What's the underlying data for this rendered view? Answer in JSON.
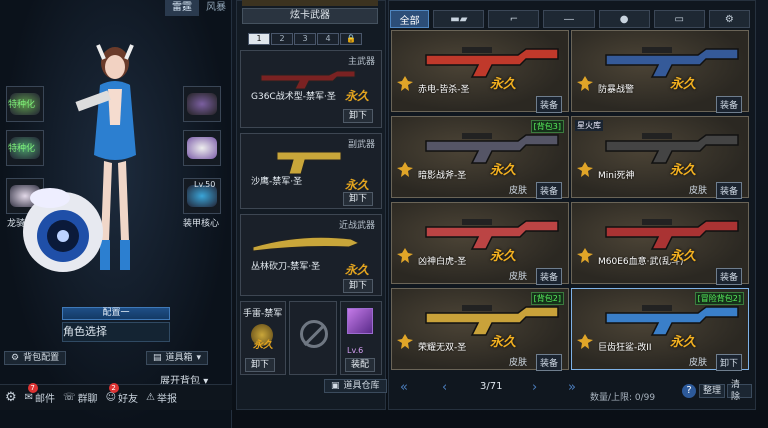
{
  "left": {
    "tabs": [
      "雷霆",
      "风暴"
    ],
    "slots_left": [
      {
        "label": "特种化"
      },
      {
        "label": "特种化"
      },
      {
        "label": "龙骑兵"
      }
    ],
    "slots_right": [
      {
        "label": ""
      },
      {
        "label": ""
      },
      {
        "label": "装甲核心",
        "level": "Lv.50"
      }
    ],
    "preset": "配置一",
    "role_select": "角色选择",
    "bag_config": "背包配置",
    "item_bag": "道具箱",
    "expand_bag": "展开背包",
    "bottom": [
      {
        "label": "邮件",
        "badge": "7"
      },
      {
        "label": "群聊"
      },
      {
        "label": "好友",
        "badge": "2"
      },
      {
        "label": "举报"
      }
    ]
  },
  "middle": {
    "header": "炫卡武器",
    "bag_tabs": [
      "1",
      "2",
      "3",
      "4"
    ],
    "equip": [
      {
        "category": "主武器",
        "name": "G36C战术型-禁军·圣",
        "perm": "永久",
        "btn": "卸下"
      },
      {
        "category": "副武器",
        "name": "沙鹰-禁军·圣",
        "perm": "永久",
        "btn": "卸下"
      },
      {
        "category": "近战武器",
        "name": "丛林砍刀-禁军·圣",
        "perm": "永久",
        "btn": "卸下"
      }
    ],
    "grenade": {
      "name": "手雷-禁军",
      "perm": "永久",
      "btn": "卸下"
    },
    "extra": {
      "level": "Lv.6",
      "btn": "装配"
    },
    "bottom_btn": "道具仓库"
  },
  "inventory": {
    "filter_all": "全部",
    "items": [
      {
        "name": "赤电-皆杀-圣",
        "perm": "永久",
        "tag": "",
        "btns": [
          "装备"
        ],
        "color": "#c0392b"
      },
      {
        "name": "防暴战警",
        "perm": "永久",
        "tag": "",
        "btns": [
          "装备"
        ],
        "color": "#355a99"
      },
      {
        "name": "暗影战斧-圣",
        "perm": "永久",
        "tag": "[背包3]",
        "btns": [
          "皮肤",
          "装备"
        ],
        "color": "#556"
      },
      {
        "name": "Mini死神",
        "perm": "永久",
        "tag": "星火库",
        "btns": [
          "皮肤",
          "装备"
        ],
        "color": "#444"
      },
      {
        "name": "凶神白虎-圣",
        "perm": "永久",
        "tag": "",
        "btns": [
          "皮肤",
          "装备"
        ],
        "color": "#b44"
      },
      {
        "name": "M60E6血意·武(乱斗)",
        "perm": "永久",
        "tag": "",
        "btns": [
          "装备"
        ],
        "color": "#a33"
      },
      {
        "name": "荣耀无双-圣",
        "perm": "永久",
        "tag": "[背包2]",
        "btns": [
          "皮肤",
          "装备"
        ],
        "color": "#c9a23a"
      },
      {
        "name": "巨齿狂鲨-改II",
        "perm": "永久",
        "tag": "[冒险背包2]",
        "btns": [
          "皮肤",
          "卸下"
        ],
        "color": "#3a7fc9"
      }
    ],
    "pager": {
      "page": "3/71",
      "count": "数量/上限: 0/99",
      "sort": "整理",
      "clear": "清除"
    }
  }
}
